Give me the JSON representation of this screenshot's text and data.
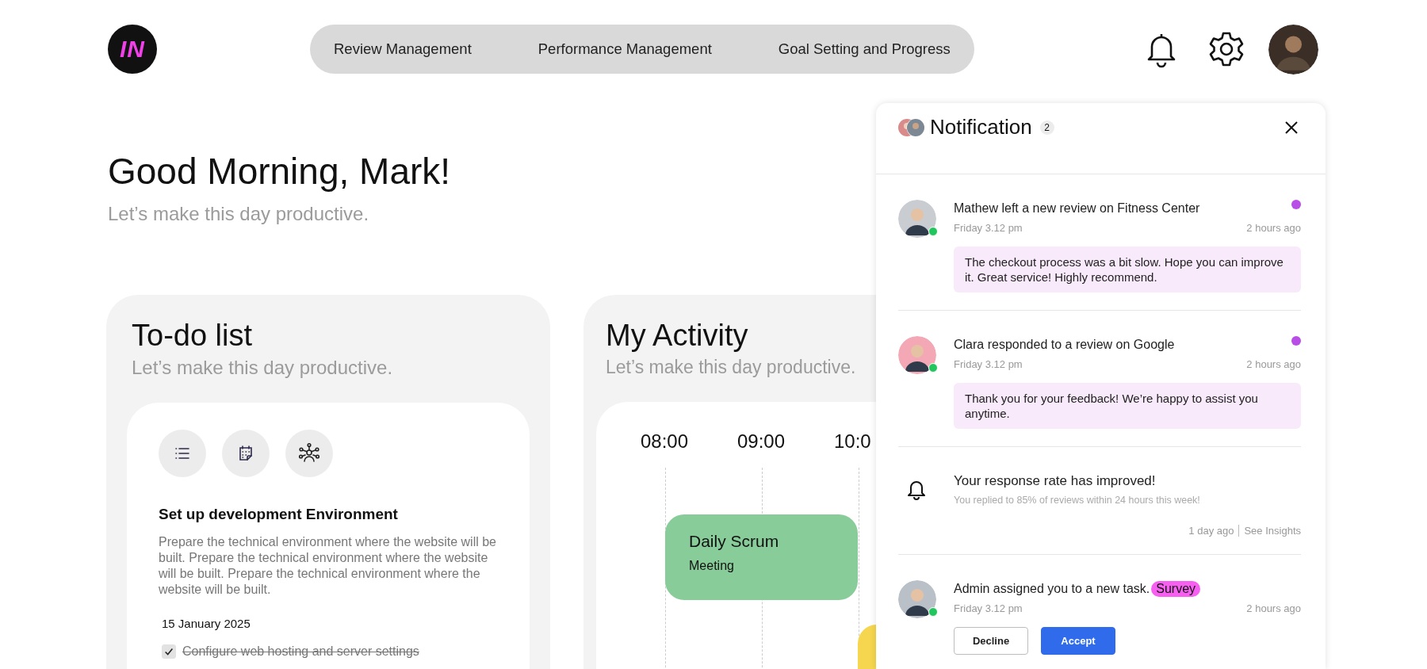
{
  "header": {
    "logo": "IN",
    "nav": [
      {
        "label": "Review Management"
      },
      {
        "label": "Performance Management"
      },
      {
        "label": "Goal Setting and Progress"
      }
    ]
  },
  "greeting": {
    "title": "Good Morning, Mark!",
    "subtitle": "Let’s make this day productive."
  },
  "todo": {
    "title": "To-do list",
    "subtitle": "Let’s make this day productive.",
    "task": {
      "title": "Set up development Environment",
      "description": "Prepare the technical environment where the website will be built. Prepare the technical environment where the website will be built. Prepare the technical environment where the website will be built.",
      "date": "15 January 2025",
      "checklist": [
        {
          "label": "Configure web hosting and server settings",
          "checked": true
        }
      ]
    }
  },
  "activity": {
    "title": "My Activity",
    "subtitle": "Let’s make this day productive.",
    "times": [
      "08:00",
      "09:00",
      "10:0"
    ],
    "events": [
      {
        "title": "Daily Scrum",
        "type": "Meeting",
        "color": "#88cc99"
      },
      {
        "color": "#f5d64e"
      }
    ]
  },
  "notifications": {
    "title": "Notification",
    "count": "2",
    "items": [
      {
        "kind": "review",
        "online": true,
        "unread": true,
        "title": "Mathew left a new review on Fitness Center",
        "time": "Friday 3.12 pm",
        "ago": "2 hours ago",
        "message": "The checkout process was a bit slow. Hope you can improve it. Great service! Highly recommend."
      },
      {
        "kind": "review",
        "online": true,
        "unread": true,
        "title": "Clara responded to a review on Google",
        "time": "Friday 3.12 pm",
        "ago": "2 hours ago",
        "message": "Thank you for your feedback! We’re happy to assist you anytime."
      },
      {
        "kind": "alert",
        "unread": false,
        "title": "Your response rate has improved!",
        "subtitle": "You replied to 85% of reviews within 24 hours this week!",
        "ago": "1 day ago",
        "link": "See Insights"
      },
      {
        "kind": "task",
        "online": true,
        "unread": false,
        "title": "Admin assigned you to a new task.",
        "tag": "Survey",
        "time": "Friday 3.12 pm",
        "ago": "2 hours ago",
        "actions": [
          {
            "label": "Decline",
            "kind": "secondary"
          },
          {
            "label": "Accept",
            "kind": "primary"
          }
        ]
      }
    ]
  }
}
